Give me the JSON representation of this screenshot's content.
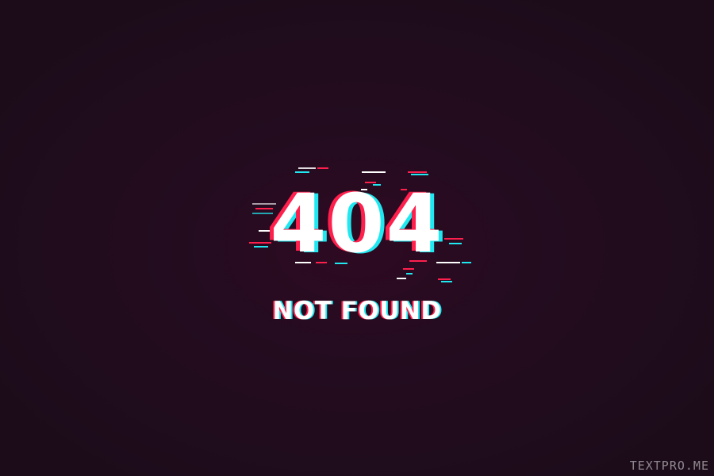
{
  "headline": "404",
  "subtitle": "NOT FOUND",
  "watermark": "TEXTPRO.ME",
  "colors": {
    "background": "#230c1f",
    "text": "#ffffff",
    "glitch_red": "#ff1f4c",
    "glitch_cyan": "#1fe8f0"
  }
}
